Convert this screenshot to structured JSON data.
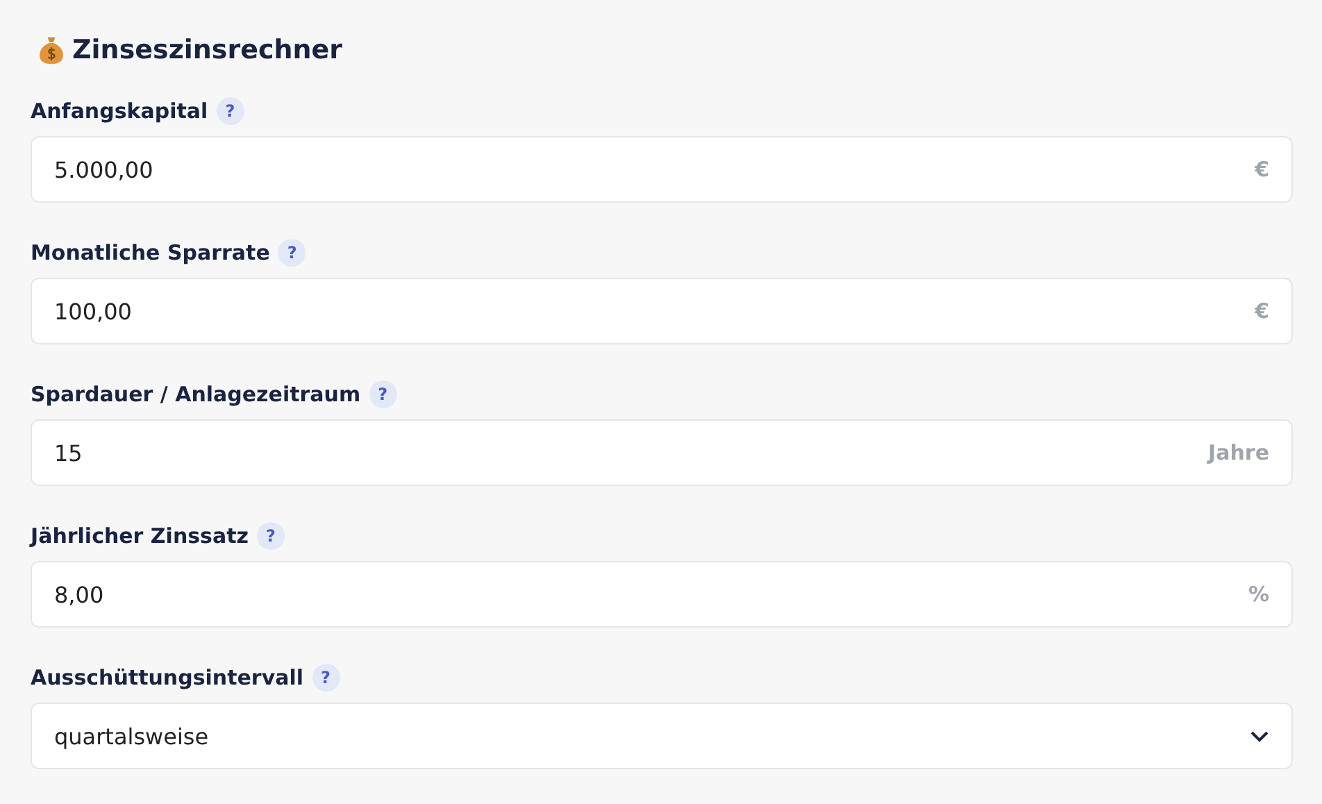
{
  "title": "Zinseszinsrechner",
  "fields": [
    {
      "kind": "input",
      "label": "Anfangskapital",
      "help": "?",
      "value": "5.000,00",
      "unit": "€"
    },
    {
      "kind": "input",
      "label": "Monatliche Sparrate",
      "help": "?",
      "value": "100,00",
      "unit": "€"
    },
    {
      "kind": "input",
      "label": "Spardauer / Anlagezeitraum",
      "help": "?",
      "value": "15",
      "unit": "Jahre"
    },
    {
      "kind": "input",
      "label": "Jährlicher Zinssatz",
      "help": "?",
      "value": "8,00",
      "unit": "%"
    },
    {
      "kind": "select",
      "label": "Ausschüttungsintervall",
      "help": "?",
      "value": "quartalsweise"
    }
  ]
}
